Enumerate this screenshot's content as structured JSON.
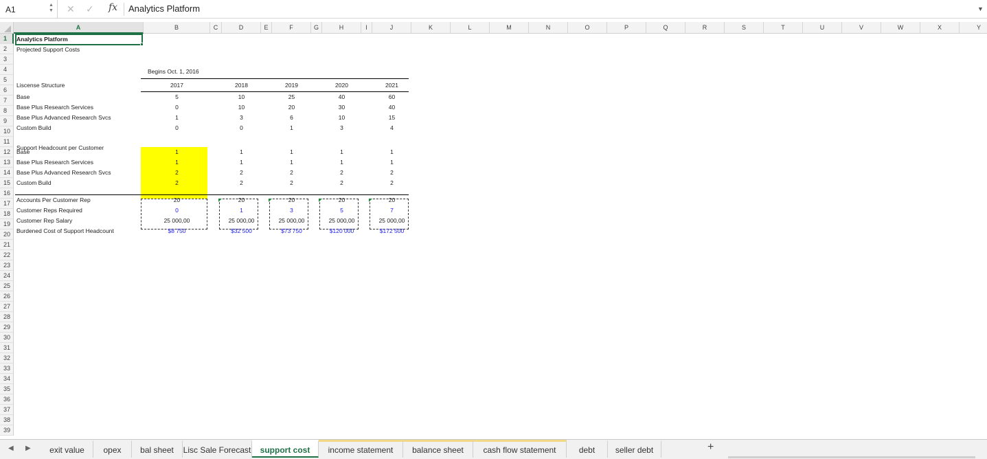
{
  "formula_bar": {
    "name_box": "A1",
    "cancel_icon": "✕",
    "confirm_icon": "✓",
    "fx_label": "fx",
    "content": "Analytics Platform"
  },
  "columns": [
    "A",
    "B",
    "C",
    "D",
    "E",
    "F",
    "G",
    "H",
    "I",
    "J",
    "K",
    "L",
    "M",
    "N",
    "O",
    "P",
    "Q",
    "R",
    "S",
    "T",
    "U",
    "V",
    "W",
    "X",
    "Y",
    "Z"
  ],
  "rows": [
    "1",
    "2",
    "3",
    "4",
    "5",
    "6",
    "7",
    "8",
    "9",
    "10",
    "11",
    "12",
    "13",
    "14",
    "15",
    "16",
    "17",
    "18",
    "19",
    "20",
    "21",
    "22",
    "23",
    "24",
    "25",
    "26",
    "27",
    "28",
    "29",
    "30",
    "31",
    "32",
    "33",
    "34",
    "35",
    "36",
    "37",
    "38",
    "39"
  ],
  "sheet": {
    "title": "Analytics Platform",
    "subtitle": "Projected Support Costs",
    "begins_note": "Begins Oct. 1, 2016",
    "years": [
      "2017",
      "2018",
      "2019",
      "2020",
      "2021"
    ],
    "license_header": "Liscense Structure",
    "license_rows": [
      {
        "label": "Base",
        "values": [
          "5",
          "10",
          "25",
          "40",
          "60"
        ]
      },
      {
        "label": "Base Plus Research Services",
        "values": [
          "0",
          "10",
          "20",
          "30",
          "40"
        ]
      },
      {
        "label": "Base Plus Advanced Research Svcs",
        "values": [
          "1",
          "3",
          "6",
          "10",
          "15"
        ]
      },
      {
        "label": "Custom Build",
        "values": [
          "0",
          "0",
          "1",
          "3",
          "4"
        ]
      }
    ],
    "support_header": "Support Headcount per Customer",
    "support_rows": [
      {
        "label": "Base",
        "values": [
          "1",
          "1",
          "1",
          "1",
          "1"
        ]
      },
      {
        "label": "Base Plus Research Services",
        "values": [
          "1",
          "1",
          "1",
          "1",
          "1"
        ]
      },
      {
        "label": "Base Plus Advanced Research Svcs",
        "values": [
          "2",
          "2",
          "2",
          "2",
          "2"
        ]
      },
      {
        "label": "Custom Build",
        "values": [
          "2",
          "2",
          "2",
          "2",
          "2"
        ]
      }
    ],
    "accounts_label": "Accounts Per Customer Rep",
    "accounts_values": [
      "20",
      "20",
      "20",
      "20",
      "20"
    ],
    "reps_label": "Customer Reps Required",
    "reps_values": [
      "0",
      "1",
      "3",
      "5",
      "7"
    ],
    "salary_label": "Customer Rep Salary",
    "salary_values": [
      "25 000,00",
      "25 000,00",
      "25 000,00",
      "25 000,00",
      "25 000,00"
    ],
    "burdened_label": "Burdened Cost of Support Headcount",
    "burdened_values": [
      "$8 750",
      "$32 500",
      "$73 750",
      "$120 000",
      "$172 500"
    ]
  },
  "tabs": [
    {
      "label": "exit value"
    },
    {
      "label": "opex"
    },
    {
      "label": "bal sheet"
    },
    {
      "label": "Lisc Sale Forecast"
    },
    {
      "label": "support cost"
    },
    {
      "label": "income statement"
    },
    {
      "label": "balance sheet"
    },
    {
      "label": "cash flow statement"
    },
    {
      "label": "debt"
    },
    {
      "label": "seller debt"
    }
  ],
  "add_sheet": "+",
  "colors": {
    "accent": "#1e7145",
    "highlight": "#ffff00",
    "formula_blue": "#1a1aee"
  }
}
